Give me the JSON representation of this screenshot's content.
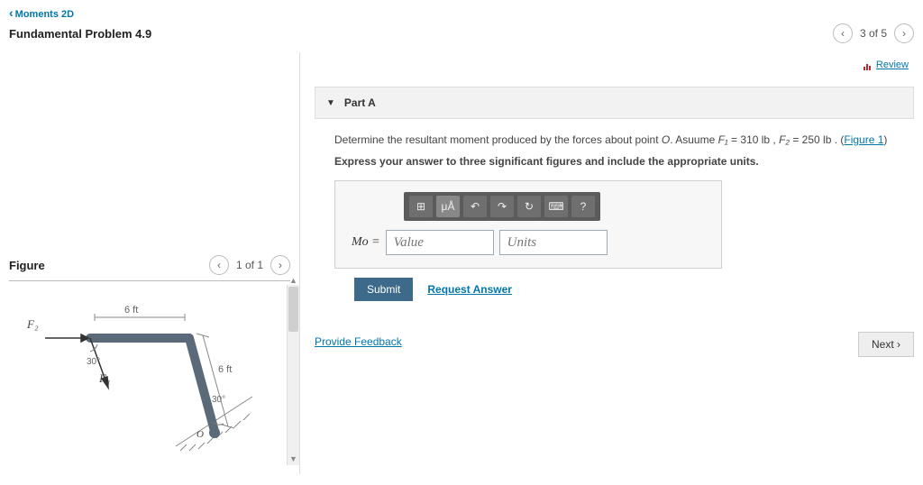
{
  "header": {
    "back_label": "Moments 2D",
    "title": "Fundamental Problem 4.9",
    "pager_text": "3 of 5"
  },
  "review_label": "Review",
  "part": {
    "label": "Part A",
    "instruction_pre": "Determine the resultant moment produced by the forces about point ",
    "point": "O",
    "instruction_mid": ". Asuume ",
    "f1_label": "F₁",
    "eq1": " = 310 lb , ",
    "f2_label": "F₂",
    "eq2": " = 250 lb . (",
    "figure_link": "Figure 1",
    "instruction_end": ")",
    "express": "Express your answer to three significant figures and include the appropriate units.",
    "mo_label": "Mᴏ",
    "equals": " = ",
    "value_placeholder": "Value",
    "units_placeholder": "Units",
    "toolbar": {
      "templates": "⊞",
      "special": "μÅ",
      "undo": "↶",
      "redo": "↷",
      "reset": "↻",
      "keyboard": "⌨",
      "help": "?"
    },
    "submit_label": "Submit",
    "request_label": "Request Answer"
  },
  "feedback_label": "Provide Feedback",
  "next_label": "Next ›",
  "figure": {
    "title": "Figure",
    "pager": "1 of 1",
    "dim1": "6 ft",
    "dim2": "6 ft",
    "angle1": "30°",
    "angle2": "30°",
    "F1": "F₁",
    "F2": "F₂",
    "O": "O"
  }
}
